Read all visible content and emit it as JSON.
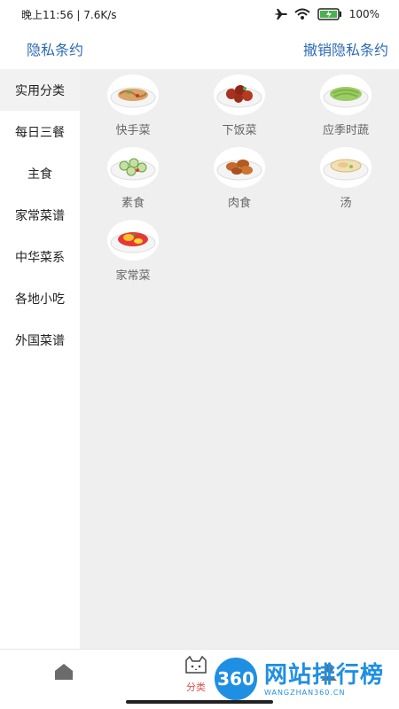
{
  "status": {
    "time": "晚上11:56",
    "speed": "7.6K/s",
    "battery": "100%",
    "icons": [
      "airplane-icon",
      "wifi-icon",
      "battery-icon"
    ]
  },
  "header": {
    "privacy_label": "隐私条约",
    "revoke_label": "撤销隐私条约",
    "link_color": "#2e6bb5"
  },
  "sidebar": {
    "items": [
      {
        "label": "实用分类",
        "active": true
      },
      {
        "label": "每日三餐"
      },
      {
        "label": "主食"
      },
      {
        "label": "家常菜谱"
      },
      {
        "label": "中华菜系"
      },
      {
        "label": "各地小吃"
      },
      {
        "label": "外国菜谱"
      }
    ]
  },
  "categories": [
    {
      "label": "快手菜",
      "icon": "noodle-dish-icon"
    },
    {
      "label": "下饭菜",
      "icon": "braised-meat-icon"
    },
    {
      "label": "应季时蔬",
      "icon": "green-vegetable-icon"
    },
    {
      "label": "素食",
      "icon": "cucumber-salad-icon"
    },
    {
      "label": "肉食",
      "icon": "fried-chicken-icon"
    },
    {
      "label": "汤",
      "icon": "soup-bowl-icon"
    },
    {
      "label": "家常菜",
      "icon": "tomato-egg-icon"
    }
  ],
  "tabbar": {
    "category_label": "分类",
    "active_color": "#e0504a"
  },
  "watermark": {
    "badge": "360",
    "main": "网站排行榜",
    "sub": "WANGZHAN360.CN"
  }
}
